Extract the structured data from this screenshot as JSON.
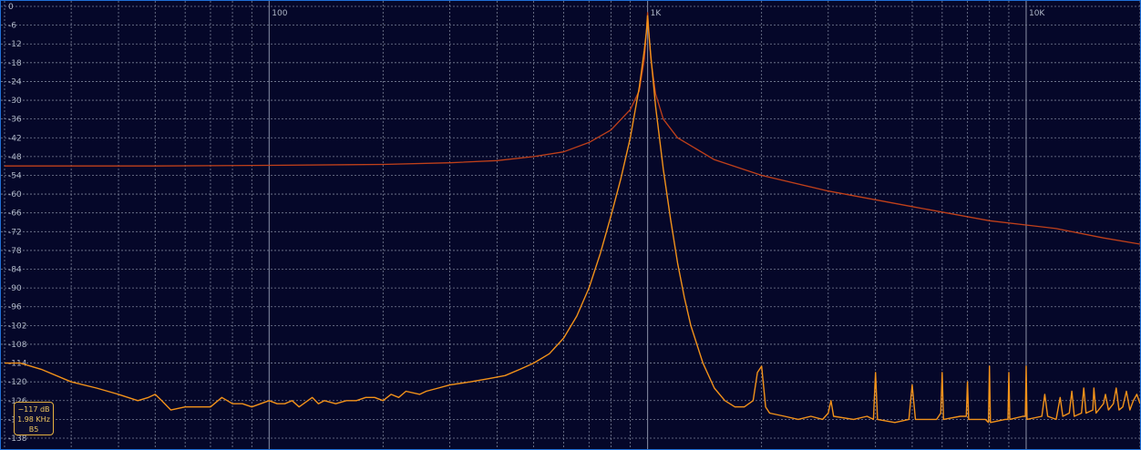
{
  "chart_data": {
    "type": "line",
    "title": "",
    "xlabel": "",
    "ylabel": "",
    "xscale": "log",
    "xlim": [
      20,
      20000
    ],
    "ylim": [
      -138,
      0
    ],
    "grid": true,
    "y_ticks": [
      "0",
      "-6",
      "-12",
      "-18",
      "-24",
      "-30",
      "-36",
      "-42",
      "-48",
      "-54",
      "-60",
      "-66",
      "-72",
      "-78",
      "-84",
      "-90",
      "-96",
      "-102",
      "-108",
      "-114",
      "-120",
      "-126",
      "-132",
      "-138"
    ],
    "x_tick_labels": [
      {
        "x": 100,
        "label": "100"
      },
      {
        "x": 1000,
        "label": "1K"
      },
      {
        "x": 10000,
        "label": "10K"
      }
    ],
    "series": [
      {
        "color": "#c0401a",
        "points": [
          [
            20,
            -51
          ],
          [
            50,
            -51
          ],
          [
            100,
            -50.8
          ],
          [
            200,
            -50.5
          ],
          [
            300,
            -50
          ],
          [
            400,
            -49.3
          ],
          [
            500,
            -48
          ],
          [
            600,
            -46.5
          ],
          [
            700,
            -43.5
          ],
          [
            800,
            -39.5
          ],
          [
            900,
            -33
          ],
          [
            950,
            -27
          ],
          [
            980,
            -17
          ],
          [
            990,
            -10
          ],
          [
            1000,
            -2
          ],
          [
            1010,
            -10
          ],
          [
            1020,
            -17
          ],
          [
            1050,
            -28
          ],
          [
            1100,
            -36
          ],
          [
            1200,
            -42
          ],
          [
            1500,
            -49
          ],
          [
            2000,
            -54
          ],
          [
            3000,
            -59
          ],
          [
            5000,
            -64
          ],
          [
            8000,
            -68.5
          ],
          [
            12000,
            -71
          ],
          [
            16000,
            -74
          ],
          [
            20000,
            -76
          ]
        ]
      },
      {
        "color": "#f2921a",
        "points": [
          [
            20,
            -114
          ],
          [
            22,
            -114
          ],
          [
            25,
            -116
          ],
          [
            30,
            -120
          ],
          [
            35,
            -122
          ],
          [
            40,
            -124
          ],
          [
            45,
            -126
          ],
          [
            48,
            -125
          ],
          [
            50,
            -124
          ],
          [
            52,
            -126
          ],
          [
            55,
            -129
          ],
          [
            60,
            -128
          ],
          [
            65,
            -128
          ],
          [
            70,
            -128
          ],
          [
            75,
            -125
          ],
          [
            80,
            -127
          ],
          [
            85,
            -127
          ],
          [
            90,
            -128
          ],
          [
            100,
            -126
          ],
          [
            105,
            -127
          ],
          [
            110,
            -127
          ],
          [
            115,
            -126
          ],
          [
            120,
            -128
          ],
          [
            130,
            -125
          ],
          [
            135,
            -127
          ],
          [
            140,
            -126
          ],
          [
            150,
            -127
          ],
          [
            160,
            -126
          ],
          [
            170,
            -126
          ],
          [
            180,
            -125
          ],
          [
            190,
            -125
          ],
          [
            200,
            -126
          ],
          [
            210,
            -124
          ],
          [
            220,
            -125
          ],
          [
            230,
            -123
          ],
          [
            250,
            -124
          ],
          [
            260,
            -123
          ],
          [
            280,
            -122
          ],
          [
            300,
            -121
          ],
          [
            340,
            -120
          ],
          [
            380,
            -119
          ],
          [
            420,
            -118
          ],
          [
            460,
            -116
          ],
          [
            500,
            -114
          ],
          [
            550,
            -111
          ],
          [
            600,
            -106
          ],
          [
            650,
            -99
          ],
          [
            700,
            -90
          ],
          [
            750,
            -79
          ],
          [
            800,
            -67
          ],
          [
            850,
            -55
          ],
          [
            900,
            -42
          ],
          [
            950,
            -26
          ],
          [
            980,
            -14
          ],
          [
            995,
            -7
          ],
          [
            1000,
            -3
          ],
          [
            1005,
            -7
          ],
          [
            1020,
            -16
          ],
          [
            1050,
            -32
          ],
          [
            1100,
            -52
          ],
          [
            1150,
            -68
          ],
          [
            1200,
            -82
          ],
          [
            1250,
            -93
          ],
          [
            1300,
            -102
          ],
          [
            1400,
            -114
          ],
          [
            1500,
            -122
          ],
          [
            1600,
            -126
          ],
          [
            1700,
            -128
          ],
          [
            1800,
            -128
          ],
          [
            1900,
            -126
          ],
          [
            1950,
            -117
          ],
          [
            2000,
            -115
          ],
          [
            2050,
            -128
          ],
          [
            2100,
            -130
          ],
          [
            2300,
            -131
          ],
          [
            2500,
            -132
          ],
          [
            2700,
            -131
          ],
          [
            2900,
            -132
          ],
          [
            3000,
            -130
          ],
          [
            3050,
            -126
          ],
          [
            3100,
            -131
          ],
          [
            3500,
            -132
          ],
          [
            3800,
            -131
          ],
          [
            3950,
            -132
          ],
          [
            4000,
            -117
          ],
          [
            4050,
            -132
          ],
          [
            4500,
            -133
          ],
          [
            4900,
            -132
          ],
          [
            5000,
            -121
          ],
          [
            5100,
            -132
          ],
          [
            5800,
            -132
          ],
          [
            5950,
            -130
          ],
          [
            6000,
            -117
          ],
          [
            6050,
            -132
          ],
          [
            6700,
            -131
          ],
          [
            6950,
            -131
          ],
          [
            7000,
            -120
          ],
          [
            7050,
            -132
          ],
          [
            7800,
            -132
          ],
          [
            7950,
            -133
          ],
          [
            8000,
            -115
          ],
          [
            8050,
            -133
          ],
          [
            8800,
            -132
          ],
          [
            8950,
            -132
          ],
          [
            9000,
            -117
          ],
          [
            9050,
            -132
          ],
          [
            9800,
            -131
          ],
          [
            9950,
            -131
          ],
          [
            10000,
            -115
          ],
          [
            10050,
            -132
          ],
          [
            11000,
            -131
          ],
          [
            11200,
            -124
          ],
          [
            11400,
            -131
          ],
          [
            12000,
            -132
          ],
          [
            12300,
            -125
          ],
          [
            12500,
            -131
          ],
          [
            13000,
            -130
          ],
          [
            13200,
            -123
          ],
          [
            13400,
            -131
          ],
          [
            14000,
            -130
          ],
          [
            14200,
            -122
          ],
          [
            14400,
            -130
          ],
          [
            15000,
            -129
          ],
          [
            15100,
            -122
          ],
          [
            15300,
            -130
          ],
          [
            16000,
            -127
          ],
          [
            16200,
            -124
          ],
          [
            16500,
            -129
          ],
          [
            17000,
            -127
          ],
          [
            17300,
            -122
          ],
          [
            17600,
            -129
          ],
          [
            18000,
            -128
          ],
          [
            18400,
            -123
          ],
          [
            18800,
            -129
          ],
          [
            19200,
            -126
          ],
          [
            19600,
            -124
          ],
          [
            20000,
            -127
          ]
        ]
      }
    ]
  },
  "readout": {
    "level": "−117 dB",
    "freq": "1.98 KHz",
    "note": "B5"
  }
}
